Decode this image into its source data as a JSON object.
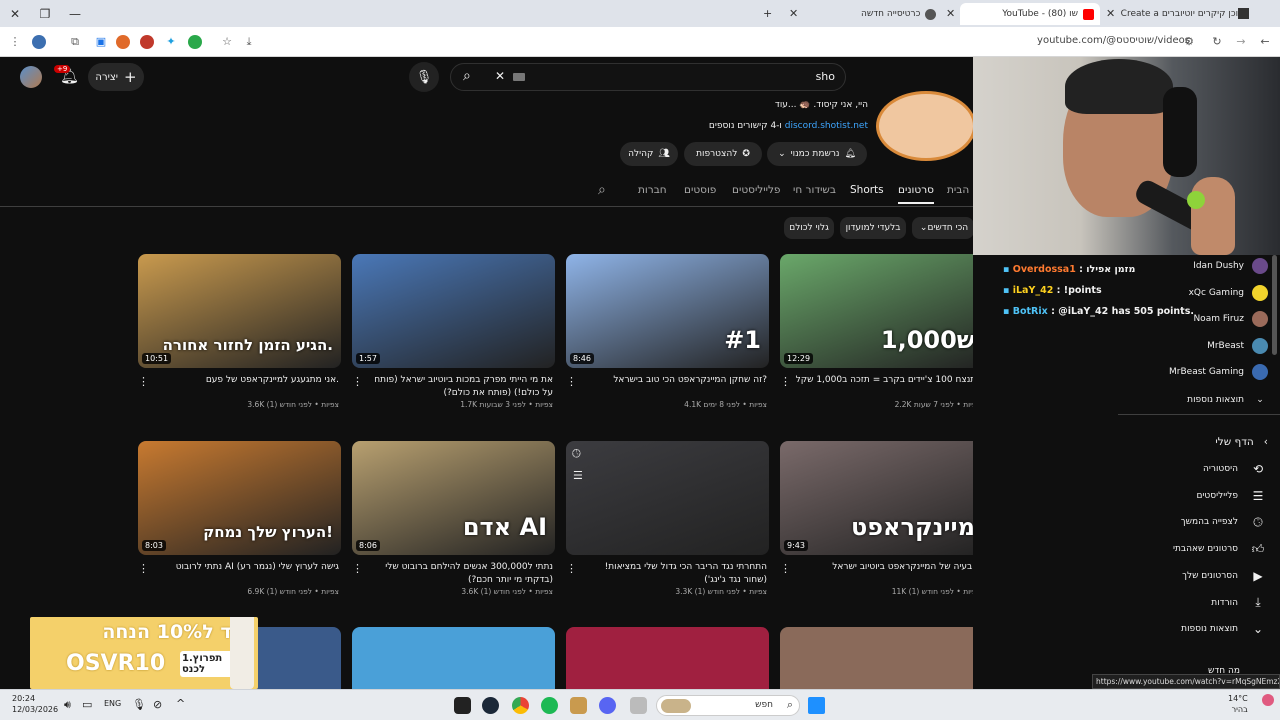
{
  "browser": {
    "tabs": [
      {
        "label": "Create a תוכן קיקרים יוטיוברים",
        "active": false
      },
      {
        "label": "YouTube - שו (80)",
        "active": true
      },
      {
        "label": "כרטיסייה חדשה",
        "active": false
      }
    ],
    "url": "youtube.com/@שוטיסטס/videos"
  },
  "header": {
    "search_value": "sho",
    "create_label": "יצירה",
    "notif_badge": "+9"
  },
  "channel": {
    "desc_line1": "היי, אני קיסוד. 🦔 ...עוד",
    "desc_line2_link": "discord.shotist.net",
    "desc_line2_rest": "ו-4 קישורים נוספים",
    "subscribed_label": "נרשמת כמנוי",
    "join_label": "להצטרפות",
    "community_label": "קהילה",
    "tabs": [
      "הבית",
      "סרטונים",
      "Shorts",
      "בשידור חי",
      "פלייליסטים",
      "פוסטים",
      "חברות"
    ],
    "active_tab": "סרטונים"
  },
  "chips": [
    "הכי חדשים",
    "בלעדי למועדון",
    "גלוי לכולם"
  ],
  "videos": [
    {
      "title": "תנצח 100 צ'יידים בקרב = תזכה ב1,000 שקל?",
      "meta": "2.2K צפיות • לפני 7 שעות",
      "duration": "12:29",
      "thumb_text": "1,000ש",
      "bg": "#6aa86a"
    },
    {
      "title": "זה שחקן המיינקראפט הכי טוב בישראל?",
      "meta": "4.1K צפיות • לפני 8 ימים",
      "duration": "8:46",
      "thumb_text": "#1",
      "bg": "#8fb4e8"
    },
    {
      "title": "את מי הייתי מפרק במכות ביוטיוב ישראל (פותח על כולם!) (פותח את כולם?)",
      "meta": "1.7K צפיות • לפני 3 שבועות",
      "duration": "1:57",
      "thumb_text": "",
      "bg": "#4a78b8"
    },
    {
      "title": "אני מתגעגע למיינקראפט של פעם.",
      "meta": "3.6K צפיות • לפני חודש (1)",
      "duration": "10:51",
      "thumb_text": "הגיע הזמן לחזור אחורה.",
      "bg": "#c99a4e"
    },
    {
      "title": "הבעיה של המיינקראפט ביוטיוב ישראל.",
      "meta": "11K צפיות • לפני חודש (1)",
      "duration": "9:43",
      "thumb_text": "מיינקראפט",
      "bg": "#7a6a6a"
    },
    {
      "title": "התחרתי נגד הריבר הכי גדול שלי במציאות! (שחור נגד ג'ינג')",
      "meta": "3.3K צפיות • לפני חודש (1)",
      "duration": "",
      "thumb_text": "",
      "bg": "#3c3c40"
    },
    {
      "title": "נתתי ל300,000 אנשים להילחם ברובוט שלי (בדקתי מי יותר חכם?)",
      "meta": "3.6K צפיות • לפני חודש (1)",
      "duration": "8:06",
      "thumb_text": "אדם  AI",
      "bg": "#b8a070"
    },
    {
      "title": "נתתי לרובוט AI גישה לערוץ שלי (נגמר רע)",
      "meta": "6.9K צפיות • לפני חודש (1)",
      "duration": "8:03",
      "thumb_text": "הערוץ שלך נמחק!",
      "bg": "#c87a30"
    }
  ],
  "chat": [
    {
      "user": "Overdossa1",
      "msg": "מזמן אפילו",
      "color": "#ff7a30"
    },
    {
      "user": "iLaY_42",
      "msg": "!points",
      "color": "#ffd21f"
    },
    {
      "user": "BotRix",
      "msg": "@iLaY_42 has 505 points.",
      "color": "#4fc3f7"
    }
  ],
  "subscriptions": [
    "Idan Dushy",
    "xQc Gaming",
    "Noam Firuz",
    "MrBeast",
    "MrBeast Gaming"
  ],
  "sidebar": {
    "more_subs": "תוצאות נוספות",
    "you_header": "הדף שלי",
    "items": [
      "היסטוריה",
      "פלייליסטים",
      "לצפייה בהמשך",
      "סרטונים שאהבתי",
      "הסרטונים שלך",
      "הורדות",
      "תוצאות נוספות"
    ],
    "bottom_partial": "מה חדש"
  },
  "promo": {
    "line1": "קוד ל10% הנחה",
    "line2": "OSVR10",
    "badge": "1.תפרוץ לכנס"
  },
  "status_url": "https://www.youtube.com/watch?v=rMqSgNEmzXo",
  "taskbar": {
    "time": "20:24",
    "date": "12/03/2026",
    "lang": "ENG",
    "search": "חפש",
    "weather_temp": "14°C",
    "weather_desc": "בהיר"
  }
}
